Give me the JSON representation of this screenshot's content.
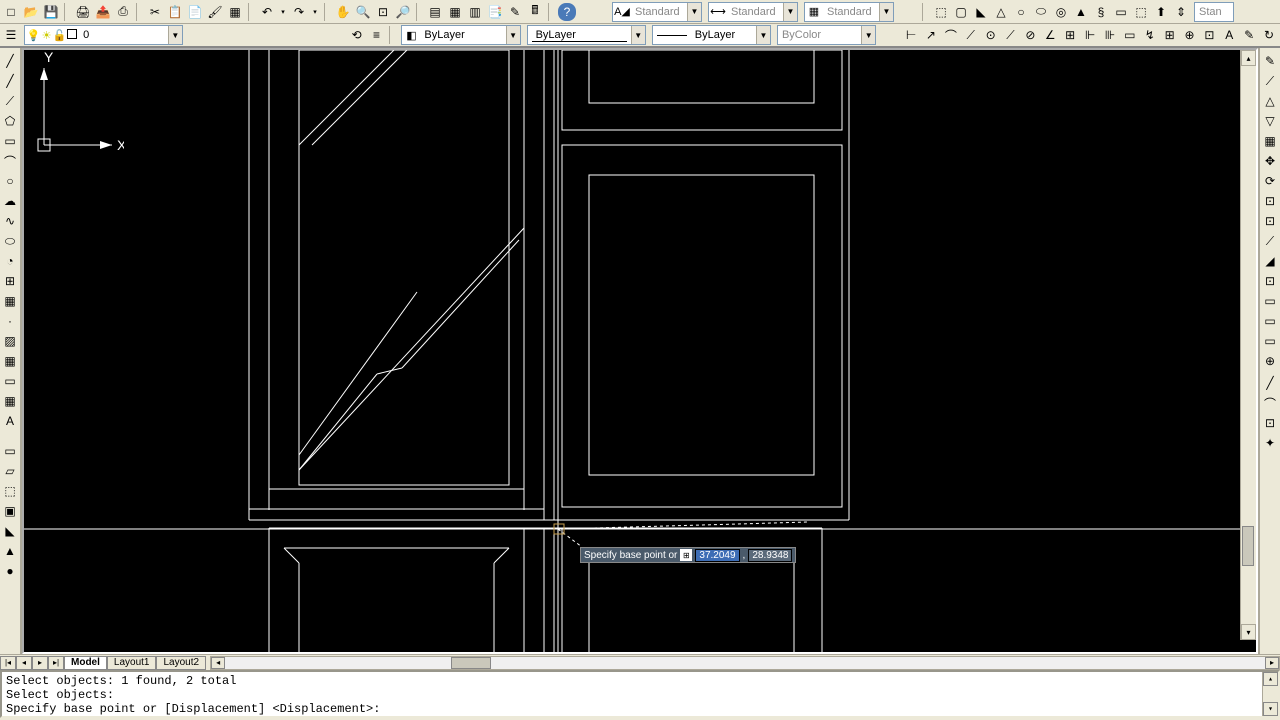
{
  "toolbar1": {
    "new": "□",
    "open": "📂",
    "save": "💾",
    "print": "🖨",
    "publish": "📤",
    "cut": "✂",
    "copy": "📋",
    "paste": "📄",
    "match": "🖌",
    "block": "▦",
    "undo": "↶",
    "redo": "↷",
    "pan": "✋",
    "zoom": "🔍",
    "zoomprev": "🔎",
    "properties": "▤",
    "designcenter": "▦",
    "toolpalettes": "▥",
    "sheetset": "📑",
    "markup": "✎",
    "calc": "🖩",
    "help": "?"
  },
  "toolbar1_right": {
    "iso": "⬚",
    "box": "▢",
    "wedge": "◣",
    "cone": "△",
    "sphere": "○",
    "cylinder": "⬭",
    "torus": "◎",
    "pyramid": "▲",
    "helix": "§",
    "polysolid": "▭"
  },
  "styles": {
    "text_label": "Standard",
    "dim_label": "Standard",
    "table_label": "Standard",
    "visual_label": "Stan"
  },
  "layers": {
    "current": "0",
    "bylayer": "ByLayer",
    "bycolor": "ByColor"
  },
  "tabs": {
    "model": "Model",
    "layout1": "Layout1",
    "layout2": "Layout2"
  },
  "command": {
    "line1": "Select objects: 1 found, 2 total",
    "line2": "Select objects:",
    "line3": "Specify base point or [Displacement] <Displacement>:"
  },
  "dynamic_input": {
    "prompt": "Specify base point or",
    "x": "37.2049",
    "y": "28.9348"
  },
  "ucs": {
    "x": "X",
    "y": "Y"
  },
  "toolbar2_right": [
    "⊢",
    "↗",
    "⟋",
    "⟋",
    "⊙",
    "◐",
    "◑",
    "⊗",
    "⊕",
    "⊡",
    "▫",
    "▦",
    "⊞",
    "⊙",
    "A",
    "▭",
    "⊞"
  ],
  "left_tools": [
    "╱",
    "╱",
    "⟋",
    "⬠",
    "▭",
    "⌒",
    "○",
    "◠",
    "∿",
    "⌓",
    "◔",
    "∞",
    "□",
    "▦",
    "▭",
    "▤",
    "A"
  ],
  "left_tools2": [
    "▭",
    "▱",
    "⬚",
    "▣",
    "▦",
    "▥",
    "◆"
  ],
  "right_tools": [
    "✎",
    "⟋",
    "△",
    "▽",
    "△",
    "▦",
    "⟳",
    "⊡",
    "⊡",
    "⟋",
    "◢",
    "⊡",
    "▭",
    "▭",
    "▭",
    "▭",
    "⊕"
  ],
  "right_tools2": [
    "╱",
    "⌒",
    "⊡",
    "✦"
  ]
}
